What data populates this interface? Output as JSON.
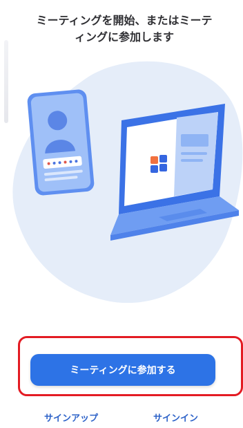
{
  "heading": {
    "line1": "ミーティングを開始、またはミーテ",
    "line2": "ィングに参加します"
  },
  "cta": {
    "join_label": "ミーティングに参加する"
  },
  "links": {
    "signup_label": "サインアップ",
    "signin_label": "サインイン"
  },
  "colors": {
    "accent": "#2d73e6",
    "highlight": "#e31b23",
    "link": "#2d62c8",
    "illustration_blob": "#e4ecf9"
  },
  "icons": [
    "contact-card-icon",
    "laptop-icon",
    "app-grid-icon"
  ]
}
